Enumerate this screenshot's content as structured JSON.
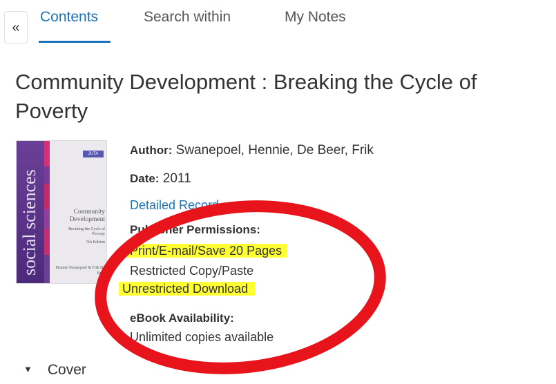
{
  "toolbar": {
    "collapse_symbol": "«"
  },
  "tabs": [
    {
      "label": "Contents",
      "active": true
    },
    {
      "label": "Search within",
      "active": false
    },
    {
      "label": "My Notes",
      "active": false
    }
  ],
  "book": {
    "title": "Community Development : Breaking the Cycle of Poverty",
    "cover": {
      "series": "social sciences",
      "publisher_logo": "JUTA",
      "title": "Community Development",
      "subtitle": "Breaking the Cycle of Poverty",
      "edition": "5th Edition",
      "authors": "Hennie Swanepoel & Frik De Beer"
    },
    "author_label": "Author:",
    "author_value": "Swanepoel, Hennie, De Beer, Frik",
    "date_label": "Date:",
    "date_value": "2011",
    "detailed_record": "Detailed Record",
    "permissions_heading": "Publisher Permissions:",
    "permissions": [
      "Print/E-mail/Save 20 Pages",
      "Restricted Copy/Paste",
      "Unrestricted Download"
    ],
    "availability_heading": "eBook Availability:",
    "availability_value": "Unlimited copies available"
  },
  "toc": {
    "items": [
      {
        "label": "Cover",
        "icon": "caret-down-icon"
      }
    ]
  },
  "colors": {
    "accent": "#1a73b8",
    "highlight": "#ffff33",
    "annotation": "#e8141c",
    "cover_purple": "#6b3f98"
  }
}
